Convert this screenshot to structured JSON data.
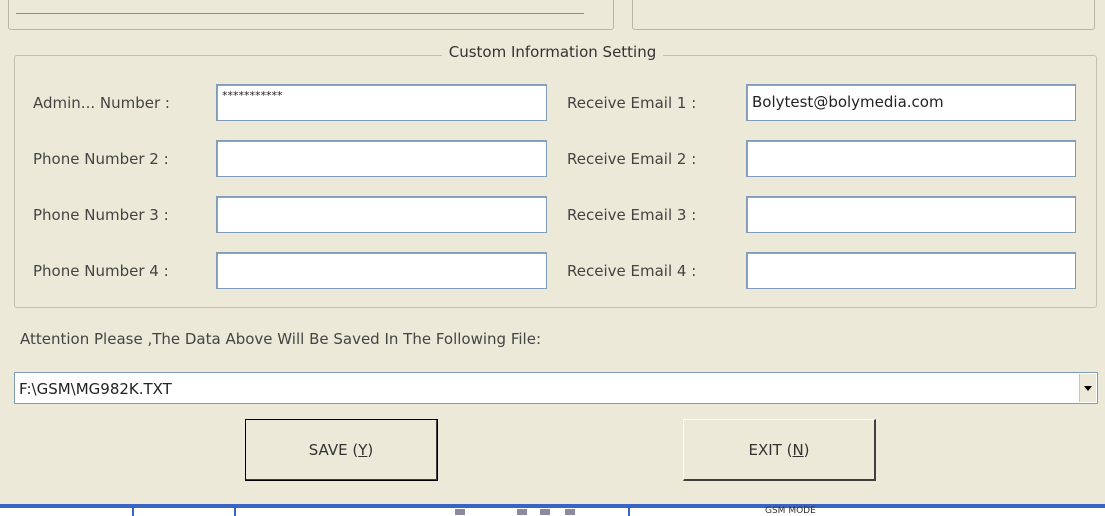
{
  "group": {
    "title": "Custom Information Setting",
    "phones": [
      {
        "label": "Admin... Number :",
        "value": "***********"
      },
      {
        "label": "Phone Number 2 :",
        "value": ""
      },
      {
        "label": "Phone Number 3 :",
        "value": ""
      },
      {
        "label": "Phone Number 4 :",
        "value": ""
      }
    ],
    "emails": [
      {
        "label": "Receive Email 1 :",
        "value": "Bolytest@bolymedia.com"
      },
      {
        "label": "Receive Email 2 :",
        "value": ""
      },
      {
        "label": "Receive Email 3 :",
        "value": ""
      },
      {
        "label": "Receive Email 4 :",
        "value": ""
      }
    ]
  },
  "attention": "Attention Please ,The Data Above Will Be Saved In The Following  File:",
  "file_path": "F:\\GSM\\MG982K.TXT",
  "buttons": {
    "save": {
      "text": "SAVE (",
      "key": "Y",
      "close": ")"
    },
    "exit": {
      "text": "EXIT (",
      "key": "N",
      "close": ")"
    }
  },
  "taskbar": {
    "item_text": "GSM MODE"
  },
  "colors": {
    "window_bg": "#ece9d8",
    "taskbar_blue": "#3a63c7",
    "field_border": "#7f9db9"
  }
}
